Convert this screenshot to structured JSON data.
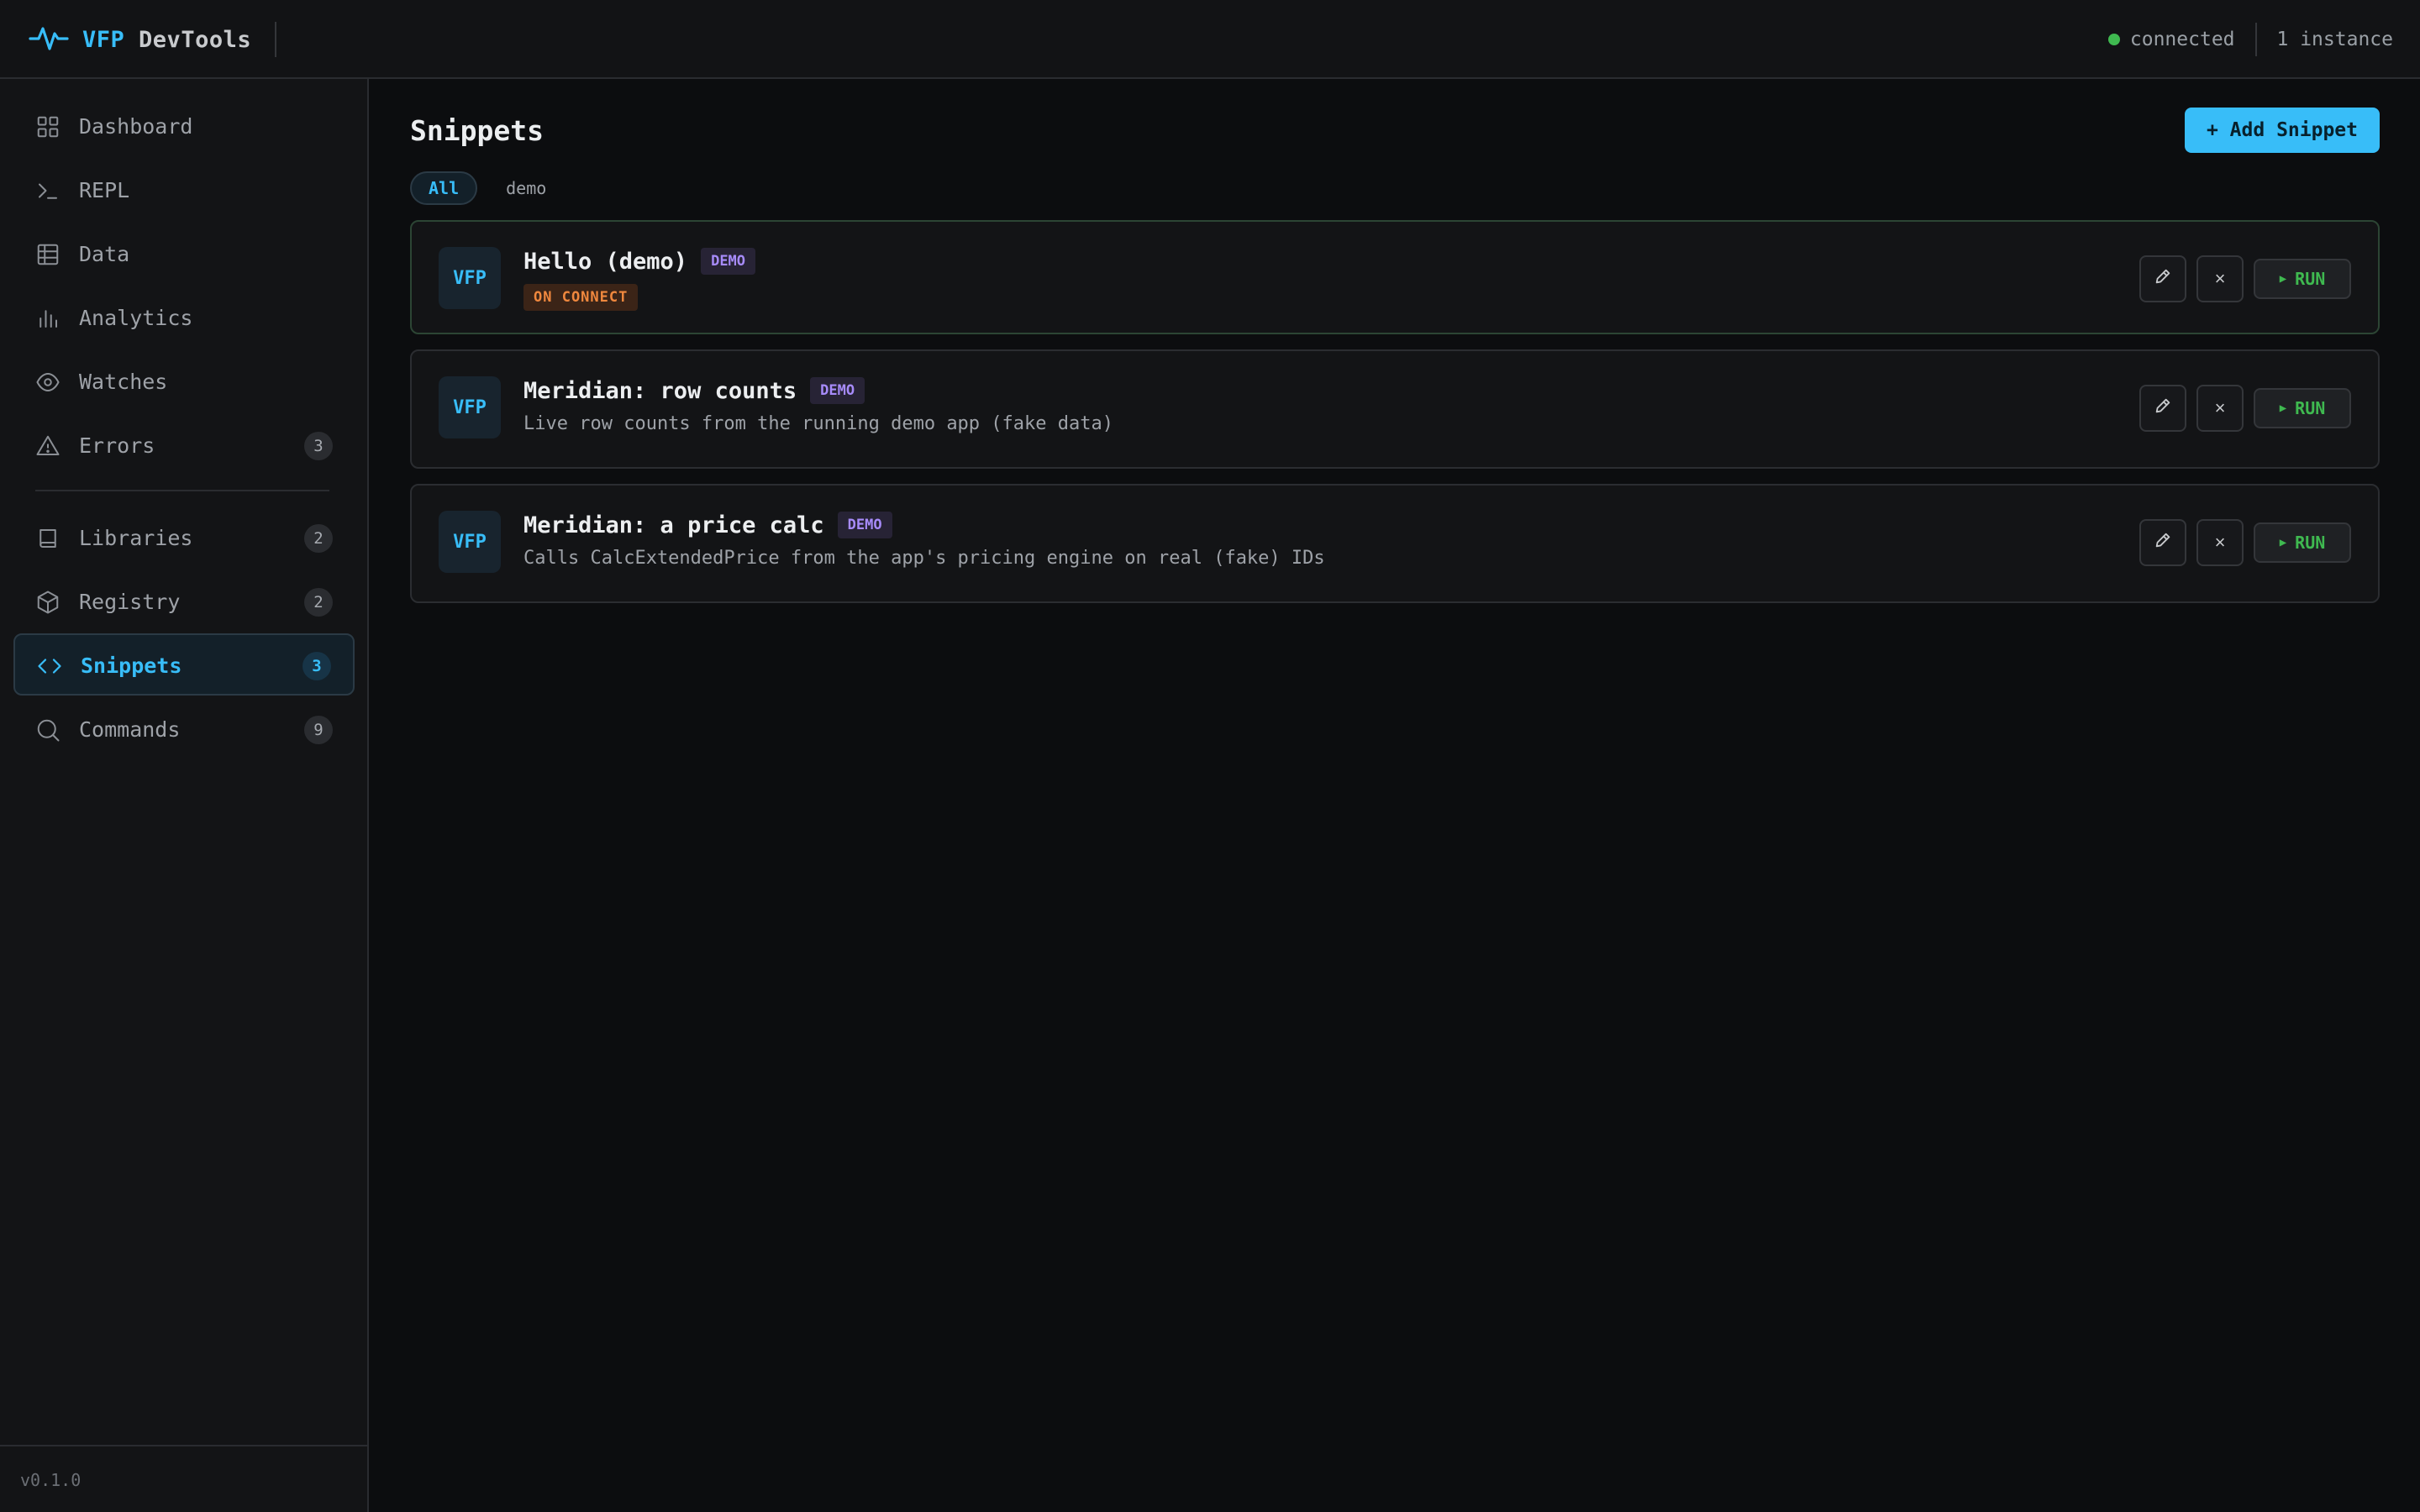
{
  "app": {
    "brand_accent": "VFP",
    "brand_rest": "DevTools"
  },
  "status": {
    "connection": "connected",
    "instances": "1 instance"
  },
  "sidebar": {
    "items": [
      {
        "label": "Dashboard",
        "icon": "grid-icon",
        "badge": ""
      },
      {
        "label": "REPL",
        "icon": "terminal-icon",
        "badge": ""
      },
      {
        "label": "Data",
        "icon": "table-icon",
        "badge": ""
      },
      {
        "label": "Analytics",
        "icon": "bar-chart-icon",
        "badge": ""
      },
      {
        "label": "Watches",
        "icon": "eye-icon",
        "badge": ""
      },
      {
        "label": "Errors",
        "icon": "warning-icon",
        "badge": "3"
      },
      {
        "label": "Libraries",
        "icon": "book-icon",
        "badge": "2"
      },
      {
        "label": "Registry",
        "icon": "package-icon",
        "badge": "2"
      },
      {
        "label": "Snippets",
        "icon": "code-icon",
        "badge": "3",
        "active": true
      },
      {
        "label": "Commands",
        "icon": "search-icon",
        "badge": "9"
      }
    ],
    "version": "v0.1.0"
  },
  "main": {
    "title": "Snippets",
    "add_button": "+ Add Snippet",
    "filters": [
      "All",
      "demo"
    ],
    "cards": [
      {
        "logo": "VFP",
        "title": "Hello (demo)",
        "tag": "DEMO",
        "trigger": "ON CONNECT",
        "description": ""
      },
      {
        "logo": "VFP",
        "title": "Meridian: row counts",
        "tag": "DEMO",
        "trigger": "",
        "description": "Live row counts from the running demo app (fake data)"
      },
      {
        "logo": "VFP",
        "title": "Meridian: a price calc",
        "tag": "DEMO",
        "trigger": "",
        "description": "Calls CalcExtendedPrice from the app's pricing engine on real (fake) IDs"
      }
    ],
    "run_label": "RUN",
    "delete_glyph": "×"
  },
  "colors": {
    "accent": "#38bdf8",
    "success": "#3fb950",
    "demo_tag": "#a78bfa",
    "on_connect_tag": "#f0883e",
    "background": "#0c0d0f"
  }
}
